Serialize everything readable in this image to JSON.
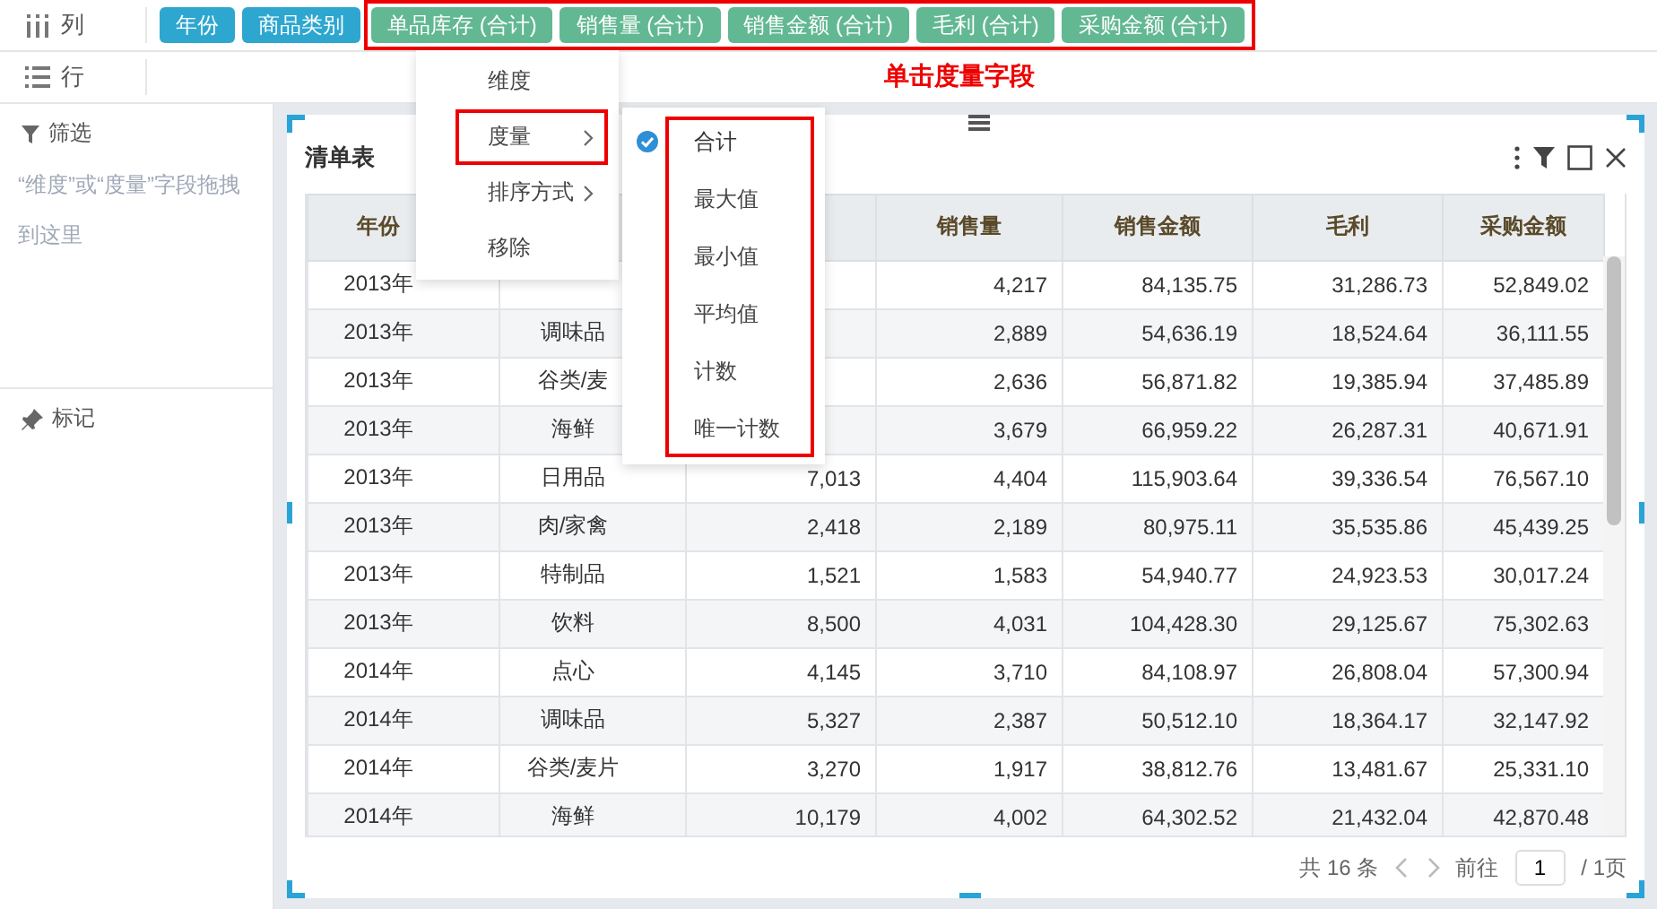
{
  "shelves": [
    {
      "kind": "columns",
      "label": "列",
      "pills": [
        {
          "label": "年份",
          "kind": "dimension"
        },
        {
          "label": "商品类别",
          "kind": "dimension"
        },
        {
          "label": "单品库存 (合计)",
          "kind": "measure"
        },
        {
          "label": "销售量 (合计)",
          "kind": "measure"
        },
        {
          "label": "销售金额 (合计)",
          "kind": "measure"
        },
        {
          "label": "毛利 (合计)",
          "kind": "measure"
        },
        {
          "label": "采购金额 (合计)",
          "kind": "measure"
        }
      ]
    },
    {
      "kind": "rows",
      "label": "行"
    }
  ],
  "annotation": {
    "label": "单击度量字段"
  },
  "sidebar": {
    "filter": {
      "title": "筛选",
      "hint": "“维度”或“度量”字段拖拽到这里"
    },
    "marks": {
      "title": "标记"
    }
  },
  "context_menu": {
    "items": [
      {
        "label": "维度",
        "submenu": false,
        "highlighted": false
      },
      {
        "label": "度量",
        "submenu": true,
        "highlighted": true
      },
      {
        "label": "排序方式",
        "submenu": true,
        "highlighted": false
      },
      {
        "label": "移除",
        "submenu": false,
        "highlighted": false
      }
    ],
    "submenu": [
      {
        "label": "合计",
        "selected": true
      },
      {
        "label": "最大值",
        "selected": false
      },
      {
        "label": "最小值",
        "selected": false
      },
      {
        "label": "平均值",
        "selected": false
      },
      {
        "label": "计数",
        "selected": false
      },
      {
        "label": "唯一计数",
        "selected": false
      }
    ]
  },
  "table": {
    "title": "清单表",
    "columns": [
      "年份",
      null,
      null,
      "销售量",
      "销售金额",
      "毛利",
      "采购金额"
    ],
    "rows": [
      [
        "2013年",
        null,
        null,
        "4,217",
        "84,135.75",
        "31,286.73",
        "52,849.02"
      ],
      [
        "2013年",
        "调味品",
        null,
        "2,889",
        "54,636.19",
        "18,524.64",
        "36,111.55"
      ],
      [
        "2013年",
        "谷类/麦",
        null,
        "2,636",
        "56,871.82",
        "19,385.94",
        "37,485.89"
      ],
      [
        "2013年",
        "海鲜",
        null,
        "3,679",
        "66,959.22",
        "26,287.31",
        "40,671.91"
      ],
      [
        "2013年",
        "日用品",
        "7,013",
        "4,404",
        "115,903.64",
        "39,336.54",
        "76,567.10"
      ],
      [
        "2013年",
        "肉/家禽",
        "2,418",
        "2,189",
        "80,975.11",
        "35,535.86",
        "45,439.25"
      ],
      [
        "2013年",
        "特制品",
        "1,521",
        "1,583",
        "54,940.77",
        "24,923.53",
        "30,017.24"
      ],
      [
        "2013年",
        "饮料",
        "8,500",
        "4,031",
        "104,428.30",
        "29,125.67",
        "75,302.63"
      ],
      [
        "2014年",
        "点心",
        "4,145",
        "3,710",
        "84,108.97",
        "26,808.04",
        "57,300.94"
      ],
      [
        "2014年",
        "调味品",
        "5,327",
        "2,387",
        "50,512.10",
        "18,364.17",
        "32,147.92"
      ],
      [
        "2014年",
        "谷类/麦片",
        "3,270",
        "1,917",
        "38,812.76",
        "13,481.67",
        "25,331.10"
      ],
      [
        "2014年",
        "海鲜",
        "10,179",
        "4,002",
        "64,302.52",
        "21,432.04",
        "42,870.48"
      ]
    ]
  },
  "pagination": {
    "total": "共 16 条",
    "goto": "前往",
    "page": "1",
    "pages": "/ 1页"
  }
}
